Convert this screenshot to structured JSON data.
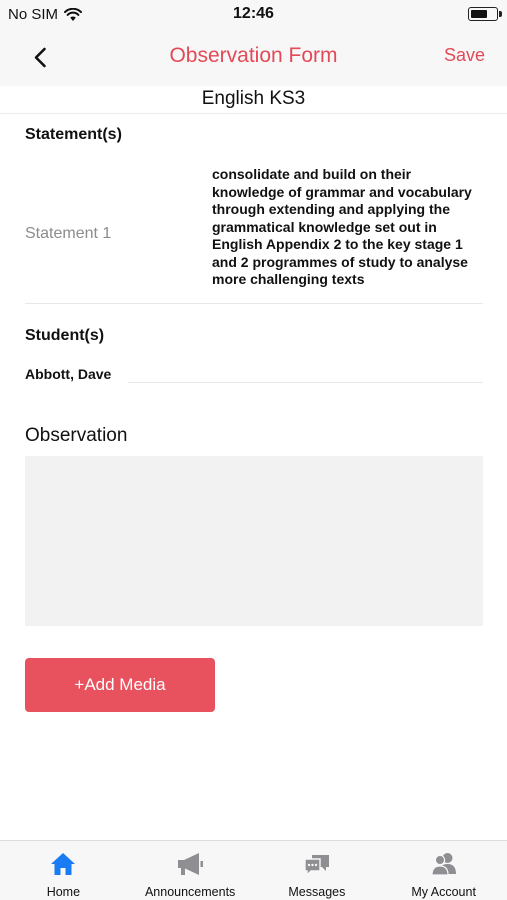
{
  "status_bar": {
    "carrier": "No SIM",
    "time": "12:46",
    "battery_level": 0.7
  },
  "nav": {
    "title": "Observation Form",
    "save_label": "Save",
    "back_icon": "chevron-left-icon"
  },
  "subject": "English KS3",
  "statements": {
    "heading": "Statement(s)",
    "items": [
      {
        "label": "Statement 1",
        "text": "consolidate and build on their knowledge of grammar and vocabulary through extending and applying the grammatical knowledge set out in English Appendix 2 to the key stage 1 and 2 programmes of study to analyse more challenging texts"
      }
    ]
  },
  "students": {
    "heading": "Student(s)",
    "items": [
      "Abbott, Dave"
    ]
  },
  "observation": {
    "heading": "Observation",
    "value": ""
  },
  "add_media_label": "+Add Media",
  "tabs": [
    {
      "label": "Home",
      "icon": "home-icon",
      "active": true
    },
    {
      "label": "Announcements",
      "icon": "megaphone-icon",
      "active": false
    },
    {
      "label": "Messages",
      "icon": "chat-bubbles-icon",
      "active": false
    },
    {
      "label": "My Account",
      "icon": "users-icon",
      "active": false
    }
  ],
  "colors": {
    "accent": "#e24a58",
    "button": "#e8525f",
    "tab_active": "#1a7cf5",
    "tab_inactive": "#8e8e93"
  }
}
